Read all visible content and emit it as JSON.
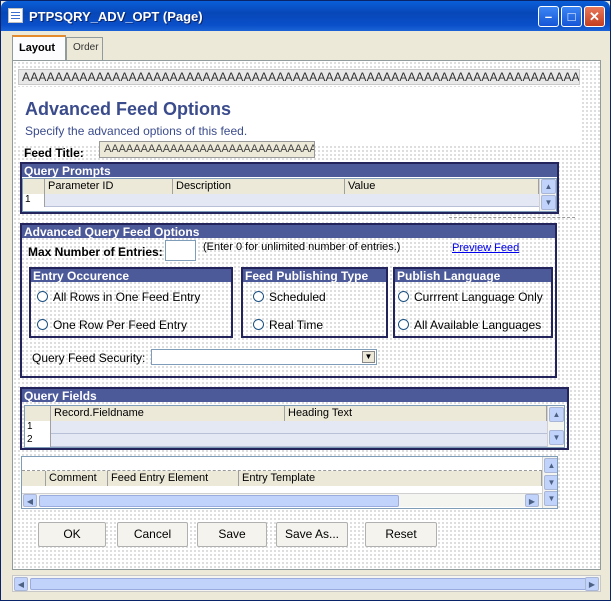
{
  "window": {
    "title": "PTPSQRY_ADV_OPT (Page)"
  },
  "tabs": [
    {
      "label": "Layout",
      "active": true
    },
    {
      "label": "Order",
      "active": false
    }
  ],
  "page": {
    "top_field": "AAAAAAAAAAAAAAAAAAAAAAAAAAAAAAAAAAAAAAAAAAAAAAAAAAAAAAAAAAAAAAAAAAAAAA",
    "heading": "Advanced Feed Options",
    "subtext": "Specify the advanced options of this feed.",
    "feed_title_label": "Feed Title:",
    "feed_title_value": "AAAAAAAAAAAAAAAAAAAAAAAAAAAAAA"
  },
  "query_prompts": {
    "title": "Query Prompts",
    "columns": [
      "Parameter ID",
      "Description",
      "Value"
    ],
    "row_numbers": [
      "1"
    ]
  },
  "advanced": {
    "title": "Advanced Query Feed Options",
    "max_entries_label": "Max Number of Entries:",
    "max_entries_hint": "(Enter 0 for unlimited number of entries.)",
    "preview_link": "Preview Feed",
    "entry_occurrence": {
      "title": "Entry Occurence",
      "options": [
        "All Rows in One Feed Entry",
        "One Row Per Feed Entry"
      ]
    },
    "publishing_type": {
      "title": "Feed Publishing Type",
      "options": [
        "Scheduled",
        "Real Time"
      ]
    },
    "publish_language": {
      "title": "Publish Language",
      "options": [
        "Currrent Language Only",
        "All Available Languages"
      ]
    },
    "security_label": "Query Feed Security:"
  },
  "query_fields": {
    "title": "Query Fields",
    "columns": [
      "Record.Fieldname",
      "Heading Text"
    ],
    "row_numbers": [
      "1",
      "2"
    ]
  },
  "entry_grid": {
    "columns": [
      "Comment",
      "Feed Entry Element",
      "Entry Template"
    ]
  },
  "buttons": {
    "ok": "OK",
    "cancel": "Cancel",
    "save": "Save",
    "save_as": "Save As...",
    "reset": "Reset"
  },
  "colors": {
    "title_bar": "#0a4fc9",
    "group_header": "#4d5a99",
    "heading_text": "#3b4c8c",
    "link": "#0000ee"
  }
}
